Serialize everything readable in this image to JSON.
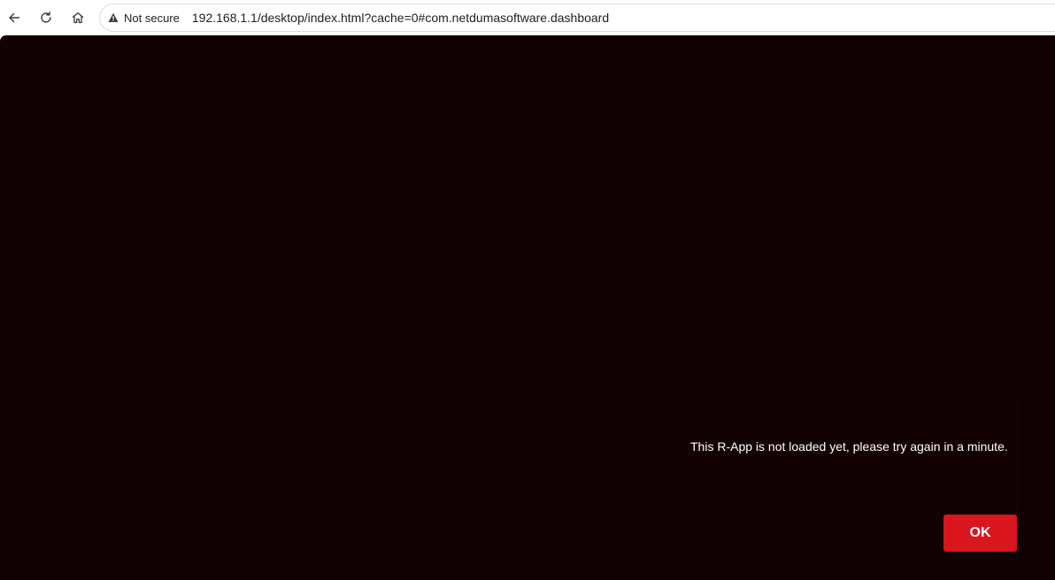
{
  "browser": {
    "security_label": "Not secure",
    "url": "192.168.1.1/desktop/index.html?cache=0#com.netdumasoftware.dashboard",
    "icons": [
      "back-arrow-icon",
      "reload-icon",
      "home-icon",
      "warning-icon"
    ]
  },
  "dialog": {
    "message": "This R-App is not loaded yet, please try again in a minute.",
    "ok_label": "OK"
  },
  "colors": {
    "page_background": "#120203",
    "accent": "#d9151d"
  }
}
